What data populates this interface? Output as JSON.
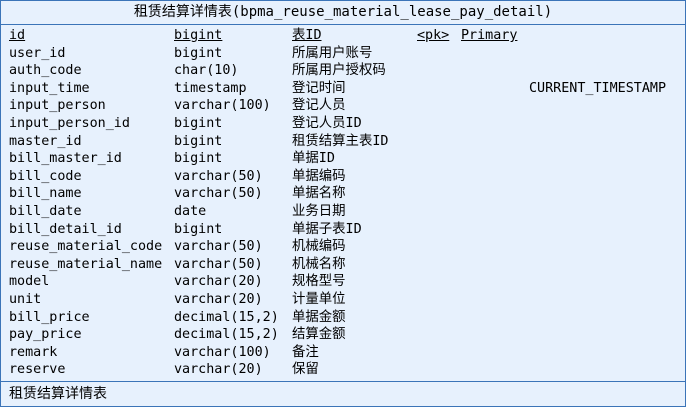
{
  "table": {
    "title": "租赁结算详情表(bpma_reuse_material_lease_pay_detail)",
    "footer": "租赁结算详情表",
    "columns": [
      {
        "name": "id",
        "type": "bigint",
        "comment": "表ID",
        "key": "<pk>",
        "key_name": "Primary",
        "default": ""
      },
      {
        "name": "user_id",
        "type": "bigint",
        "comment": "所属用户账号",
        "key": "",
        "key_name": "",
        "default": ""
      },
      {
        "name": "auth_code",
        "type": "char(10)",
        "comment": "所属用户授权码",
        "key": "",
        "key_name": "",
        "default": ""
      },
      {
        "name": "input_time",
        "type": "timestamp",
        "comment": "登记时间",
        "key": "",
        "key_name": "",
        "default": "CURRENT_TIMESTAMP"
      },
      {
        "name": "input_person",
        "type": "varchar(100)",
        "comment": "登记人员",
        "key": "",
        "key_name": "",
        "default": ""
      },
      {
        "name": "input_person_id",
        "type": "bigint",
        "comment": "登记人员ID",
        "key": "",
        "key_name": "",
        "default": ""
      },
      {
        "name": "master_id",
        "type": "bigint",
        "comment": "租赁结算主表ID",
        "key": "",
        "key_name": "",
        "default": ""
      },
      {
        "name": "bill_master_id",
        "type": "bigint",
        "comment": "单据ID",
        "key": "",
        "key_name": "",
        "default": ""
      },
      {
        "name": "bill_code",
        "type": "varchar(50)",
        "comment": "单据编码",
        "key": "",
        "key_name": "",
        "default": ""
      },
      {
        "name": "bill_name",
        "type": "varchar(50)",
        "comment": "单据名称",
        "key": "",
        "key_name": "",
        "default": ""
      },
      {
        "name": "bill_date",
        "type": "date",
        "comment": "业务日期",
        "key": "",
        "key_name": "",
        "default": ""
      },
      {
        "name": "bill_detail_id",
        "type": "bigint",
        "comment": "单据子表ID",
        "key": "",
        "key_name": "",
        "default": ""
      },
      {
        "name": "reuse_material_code",
        "type": "varchar(50)",
        "comment": "机械编码",
        "key": "",
        "key_name": "",
        "default": ""
      },
      {
        "name": "reuse_material_name",
        "type": "varchar(50)",
        "comment": "机械名称",
        "key": "",
        "key_name": "",
        "default": ""
      },
      {
        "name": "model",
        "type": "varchar(20)",
        "comment": "规格型号",
        "key": "",
        "key_name": "",
        "default": ""
      },
      {
        "name": "unit",
        "type": "varchar(20)",
        "comment": "计量单位",
        "key": "",
        "key_name": "",
        "default": ""
      },
      {
        "name": "bill_price",
        "type": "decimal(15,2)",
        "comment": "单据金额",
        "key": "",
        "key_name": "",
        "default": ""
      },
      {
        "name": "pay_price",
        "type": "decimal(15,2)",
        "comment": "结算金额",
        "key": "",
        "key_name": "",
        "default": ""
      },
      {
        "name": "remark",
        "type": "varchar(100)",
        "comment": "备注",
        "key": "",
        "key_name": "",
        "default": ""
      },
      {
        "name": "reserve",
        "type": "varchar(20)",
        "comment": "保留",
        "key": "",
        "key_name": "",
        "default": ""
      }
    ]
  },
  "colors": {
    "border": "#3b74b8",
    "background": "#e7f1fd",
    "text": "#000000"
  }
}
